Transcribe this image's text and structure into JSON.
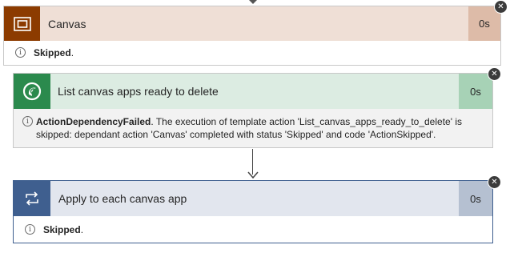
{
  "flow": {
    "actions": [
      {
        "title": "Canvas",
        "duration": "0s",
        "status_label": "Skipped",
        "status_suffix": ".",
        "icon": "scope-icon",
        "header_color": "#efdfd6",
        "accent_color": "#8c3b00"
      },
      {
        "title": "List canvas apps ready to delete",
        "duration": "0s",
        "status_label": "ActionDependencyFailed",
        "status_message": ". The execution of template action 'List_canvas_apps_ready_to_delete' is skipped: dependant action 'Canvas' completed with status 'Skipped' and code 'ActionSkipped'.",
        "icon": "dataverse-icon",
        "header_color": "#dcece2",
        "accent_color": "#2b8a4d"
      },
      {
        "title": "Apply to each canvas app",
        "duration": "0s",
        "status_label": "Skipped",
        "status_suffix": ".",
        "icon": "loop-icon",
        "header_color": "#e2e6ee",
        "accent_color": "#3f5f8f"
      }
    ],
    "close_glyph": "✕",
    "info_glyph": "i"
  }
}
